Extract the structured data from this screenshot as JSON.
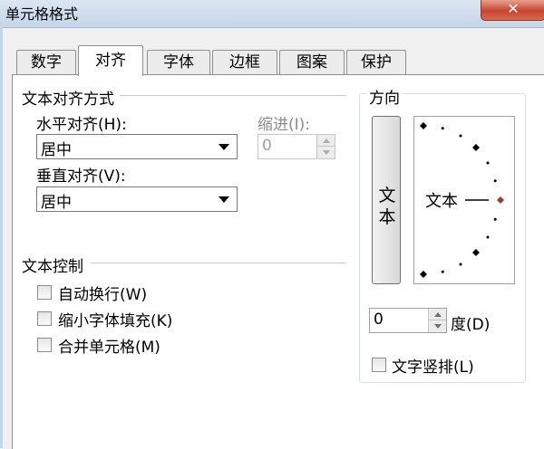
{
  "window": {
    "title": "单元格格式",
    "close_glyph": "✕"
  },
  "tabs": [
    {
      "label": "数字",
      "active": false
    },
    {
      "label": "对齐",
      "active": true
    },
    {
      "label": "字体",
      "active": false
    },
    {
      "label": "边框",
      "active": false
    },
    {
      "label": "图案",
      "active": false
    },
    {
      "label": "保护",
      "active": false
    }
  ],
  "alignment": {
    "section_title": "文本对齐方式",
    "horizontal_label": "水平对齐(H):",
    "horizontal_value": "居中",
    "indent_label": "缩进(I):",
    "indent_value": "0",
    "vertical_label": "垂直对齐(V):",
    "vertical_value": "居中"
  },
  "text_control": {
    "section_title": "文本控制",
    "options": [
      {
        "label": "自动换行(W)",
        "checked": false
      },
      {
        "label": "缩小字体填充(K)",
        "checked": false
      },
      {
        "label": "合并单元格(M)",
        "checked": false
      }
    ]
  },
  "orientation": {
    "section_title": "方向",
    "vertical_text": "文本",
    "dial_text": "文本",
    "degrees_value": "0",
    "degrees_label": "度(D)",
    "stacked_label": "文字竖排(L)",
    "stacked_checked": false,
    "dial_angle_degrees": 0
  },
  "colors": {
    "dial_marker": "#9b3a3a",
    "titlebar": "#c5d6e8"
  }
}
